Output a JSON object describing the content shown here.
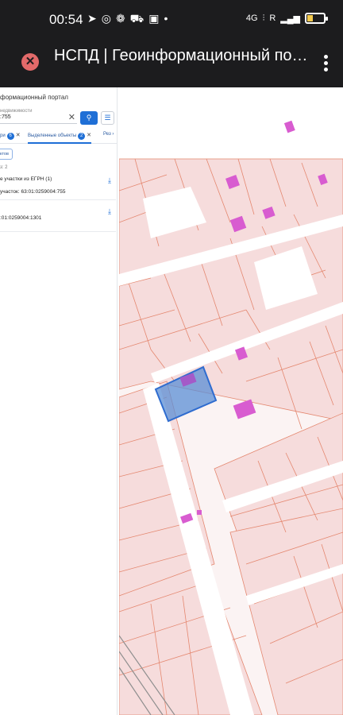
{
  "status_bar": {
    "time": "00:54",
    "left_icons": [
      "telegram-icon",
      "chrome-icon",
      "app-icon",
      "cart-icon",
      "app-icon",
      "dot-icon"
    ],
    "network": "4G",
    "roaming": "R",
    "battery_level": 0.35
  },
  "browser": {
    "title": "НСПД | Геоинформационный пор...",
    "url": ""
  },
  "panel": {
    "portal_title": "формационный портал",
    "search_label": "недвижимости",
    "search_value": ":755",
    "search_button_icon": "search-icon",
    "filter_button_icon": "filter-icon",
    "tabs": [
      {
        "label": "ри",
        "badge": "6"
      },
      {
        "label": "Выделенные объекты",
        "badge": "2"
      },
      {
        "label": "Рез"
      }
    ],
    "chip_label": "ктов",
    "count_text": "з: 2",
    "items": [
      {
        "title": "е участки из ЕГРН (1)",
        "subtitle": "участок: 63:01:0259004:755"
      },
      {
        "title": "",
        "subtitle": ":01:0259004:1301"
      }
    ]
  },
  "map": {
    "collapse_icon": "chevrons-left-icon",
    "selected_parcel_color": "#5b8fd6",
    "parcel_color": "#f6dcdc",
    "boundary_color": "#e4876f",
    "building_color": "#d85cd0"
  }
}
